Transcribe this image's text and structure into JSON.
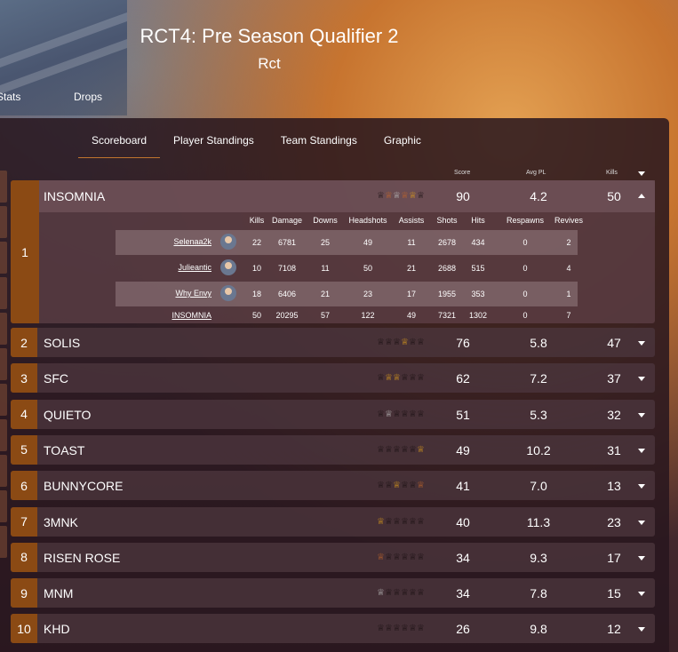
{
  "page": {
    "title": "RCT4: Pre Season Qualifier 2",
    "subtitle": "Rct"
  },
  "top_tabs": [
    "Stats",
    "Drops"
  ],
  "tabs": [
    "Scoreboard",
    "Player Standings",
    "Team Standings",
    "Graphic"
  ],
  "active_tab": "Scoreboard",
  "columns": {
    "score": "Score",
    "avg_pl": "Avg PL",
    "kills": "Kills"
  },
  "expanded_team": {
    "rank": "1",
    "name": "INSOMNIA",
    "score": "90",
    "avg_pl": "4.2",
    "kills": "50",
    "player_headers": [
      "Kills",
      "Damage",
      "Downs",
      "Headshots",
      "Assists",
      "Shots",
      "Hits",
      "Respawns",
      "Revives"
    ],
    "players": [
      {
        "name": "Selenaa2k",
        "stats": [
          "22",
          "6781",
          "25",
          "49",
          "11",
          "2678",
          "434",
          "0",
          "2"
        ]
      },
      {
        "name": "Julieantic",
        "stats": [
          "10",
          "7108",
          "11",
          "50",
          "21",
          "2688",
          "515",
          "0",
          "4"
        ]
      },
      {
        "name": "Why Envy",
        "stats": [
          "18",
          "6406",
          "21",
          "23",
          "17",
          "1955",
          "353",
          "0",
          "1"
        ]
      }
    ],
    "total": {
      "name": "INSOMNIA",
      "stats": [
        "50",
        "20295",
        "57",
        "122",
        "49",
        "7321",
        "1302",
        "0",
        "7"
      ]
    }
  },
  "teams": [
    {
      "rank": "2",
      "name": "SOLIS",
      "score": "76",
      "avg_pl": "5.8",
      "kills": "47"
    },
    {
      "rank": "3",
      "name": "SFC",
      "score": "62",
      "avg_pl": "7.2",
      "kills": "37"
    },
    {
      "rank": "4",
      "name": "QUIETO",
      "score": "51",
      "avg_pl": "5.3",
      "kills": "32"
    },
    {
      "rank": "5",
      "name": "TOAST",
      "score": "49",
      "avg_pl": "10.2",
      "kills": "31"
    },
    {
      "rank": "6",
      "name": "BUNNYCORE",
      "score": "41",
      "avg_pl": "7.0",
      "kills": "13"
    },
    {
      "rank": "7",
      "name": "3MNK",
      "score": "40",
      "avg_pl": "11.3",
      "kills": "23"
    },
    {
      "rank": "8",
      "name": "RISEN ROSE",
      "score": "34",
      "avg_pl": "9.3",
      "kills": "17"
    },
    {
      "rank": "9",
      "name": "MNM",
      "score": "34",
      "avg_pl": "7.8",
      "kills": "15"
    },
    {
      "rank": "10",
      "name": "KHD",
      "score": "26",
      "avg_pl": "9.8",
      "kills": "12"
    }
  ],
  "trophy_colors": {
    "gold": "#d99a1c",
    "silver": "#b8b8b8",
    "bronze": "#c0652a",
    "none": "#1a1012"
  },
  "trophies": {
    "INSOMNIA": [
      "none",
      "bronze",
      "silver",
      "bronze",
      "gold",
      "none"
    ],
    "SOLIS": [
      "none",
      "none",
      "none",
      "gold",
      "none",
      "none"
    ],
    "SFC": [
      "none",
      "gold",
      "gold",
      "none",
      "none",
      "none"
    ],
    "QUIETO": [
      "none",
      "silver",
      "none",
      "none",
      "none",
      "none"
    ],
    "TOAST": [
      "none",
      "none",
      "none",
      "none",
      "none",
      "gold"
    ],
    "BUNNYCORE": [
      "none",
      "none",
      "gold",
      "none",
      "none",
      "bronze"
    ],
    "3MNK": [
      "gold",
      "none",
      "none",
      "none",
      "none",
      "none"
    ],
    "RISEN ROSE": [
      "bronze",
      "none",
      "none",
      "none",
      "none",
      "none"
    ],
    "MNM": [
      "silver",
      "none",
      "none",
      "none",
      "none",
      "none"
    ],
    "KHD": [
      "none",
      "none",
      "none",
      "none",
      "none",
      "none"
    ]
  },
  "icons": {
    "trophy": "trophy-icon",
    "expand": "chevron-down-icon",
    "collapse": "chevron-up-icon"
  },
  "colors": {
    "rank_bg": "#8b4a14",
    "active_tab_underline": "#c0752e"
  }
}
